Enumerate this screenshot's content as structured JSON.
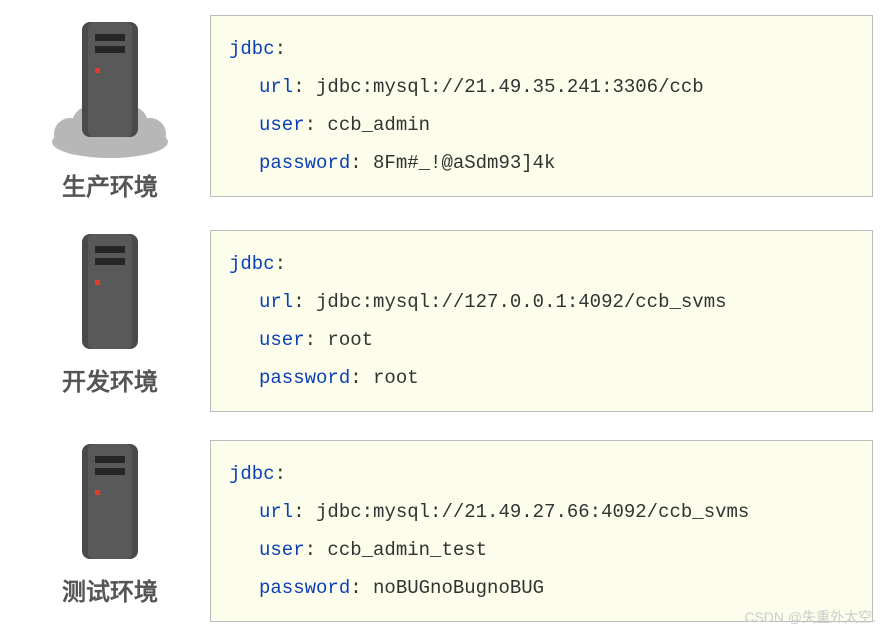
{
  "environments": [
    {
      "label": "生产环境",
      "has_cloud": true,
      "config": {
        "root_key": "jdbc",
        "url_key": "url",
        "url_val": "jdbc:mysql://21.49.35.241:3306/ccb",
        "user_key": "user",
        "user_val": "ccb_admin",
        "password_key": "password",
        "password_val": "8Fm#_!@aSdm93]4k"
      }
    },
    {
      "label": "开发环境",
      "has_cloud": false,
      "config": {
        "root_key": "jdbc",
        "url_key": "url",
        "url_val": "jdbc:mysql://127.0.0.1:4092/ccb_svms",
        "user_key": "user",
        "user_val": "root",
        "password_key": "password",
        "password_val": "root"
      }
    },
    {
      "label": "测试环境",
      "has_cloud": false,
      "config": {
        "root_key": "jdbc",
        "url_key": "url",
        "url_val": "jdbc:mysql://21.49.27.66:4092/ccb_svms",
        "user_key": "user",
        "user_val": "ccb_admin_test",
        "password_key": "password",
        "password_val": "noBUGnoBugnoBUG"
      }
    }
  ],
  "watermark": "CSDN @失重外太空."
}
